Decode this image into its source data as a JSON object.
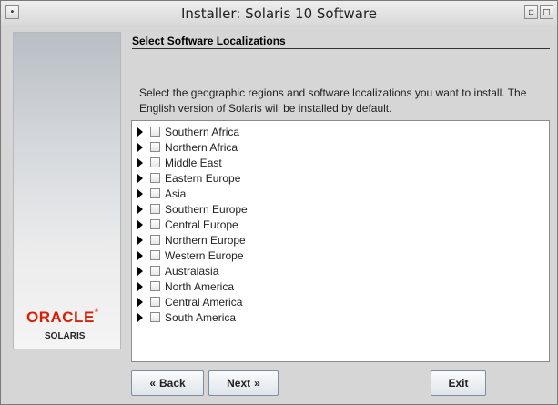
{
  "window": {
    "title": "Installer: Solaris 10 Software",
    "menu_icon": "window-menu-icon",
    "minimize_icon": "minimize-icon",
    "maximize_icon": "maximize-icon"
  },
  "branding": {
    "logo": "ORACLE",
    "product": "SOLARIS",
    "logo_color": "#d81e05"
  },
  "header": {
    "title": "Select Software Localizations"
  },
  "instructions": "Select the geographic regions and software localizations you want to install. The English version of Solaris will be installed by default.",
  "regions": [
    {
      "label": "Southern Africa",
      "checked": false,
      "expanded": false
    },
    {
      "label": "Northern Africa",
      "checked": false,
      "expanded": false
    },
    {
      "label": "Middle East",
      "checked": false,
      "expanded": false
    },
    {
      "label": "Eastern Europe",
      "checked": false,
      "expanded": false
    },
    {
      "label": "Asia",
      "checked": false,
      "expanded": false
    },
    {
      "label": "Southern Europe",
      "checked": false,
      "expanded": false
    },
    {
      "label": "Central Europe",
      "checked": false,
      "expanded": false
    },
    {
      "label": "Northern Europe",
      "checked": false,
      "expanded": false
    },
    {
      "label": "Western Europe",
      "checked": false,
      "expanded": false
    },
    {
      "label": "Australasia",
      "checked": false,
      "expanded": false
    },
    {
      "label": "North America",
      "checked": false,
      "expanded": false
    },
    {
      "label": "Central America",
      "checked": false,
      "expanded": false
    },
    {
      "label": "South America",
      "checked": false,
      "expanded": false
    }
  ],
  "buttons": {
    "back": "Back",
    "next": "Next",
    "exit": "Exit"
  }
}
